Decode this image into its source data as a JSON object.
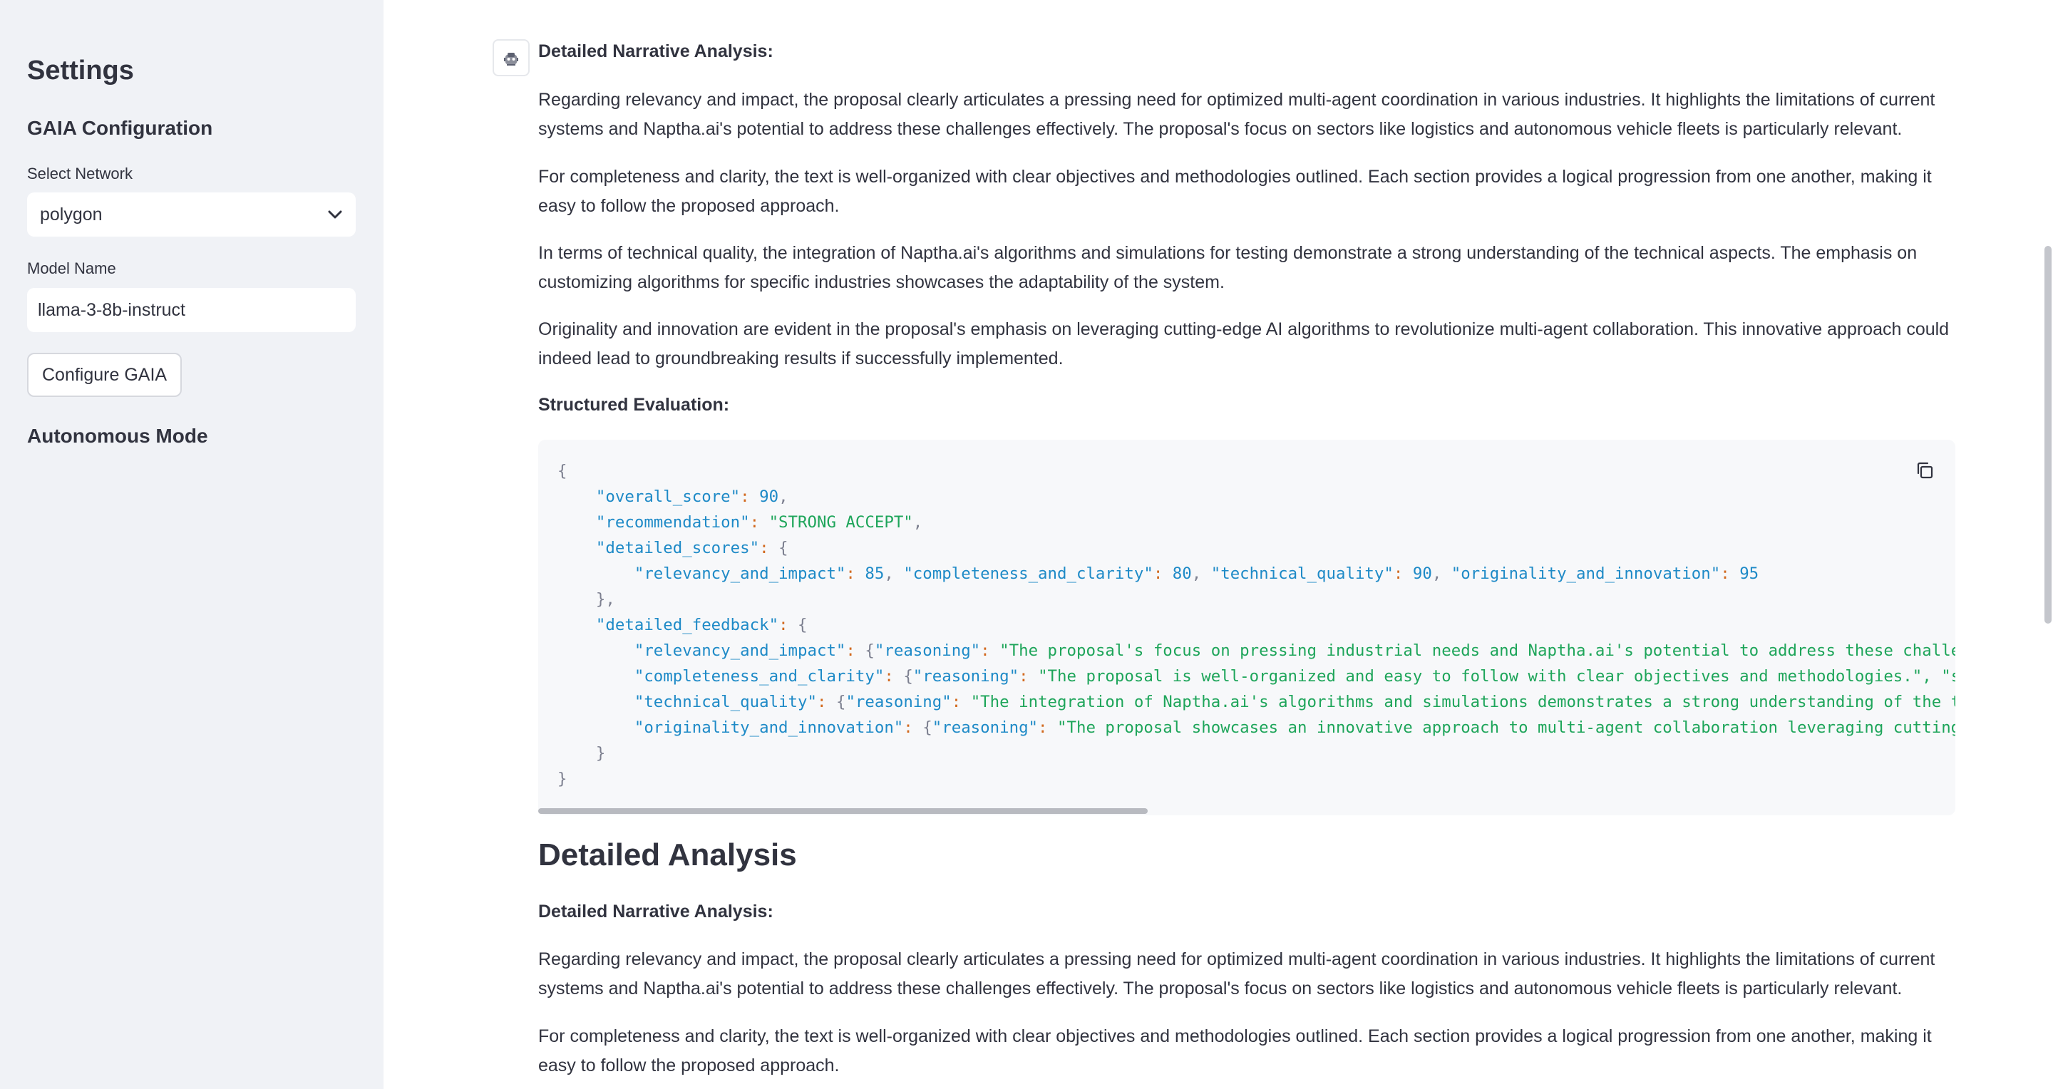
{
  "sidebar": {
    "title": "Settings",
    "section_gaia": "GAIA Configuration",
    "network_label": "Select Network",
    "network_value": "polygon",
    "model_label": "Model Name",
    "model_value": "llama-3-8b-instruct",
    "configure_button": "Configure GAIA",
    "section_autonomous": "Autonomous Mode"
  },
  "message": {
    "narrative_heading": "Detailed Narrative Analysis:",
    "paragraphs": [
      "Regarding relevancy and impact, the proposal clearly articulates a pressing need for optimized multi-agent coordination in various industries. It highlights the limitations of current systems and Naptha.ai's potential to address these challenges effectively. The proposal's focus on sectors like logistics and autonomous vehicle fleets is particularly relevant.",
      "For completeness and clarity, the text is well-organized with clear objectives and methodologies outlined. Each section provides a logical progression from one another, making it easy to follow the proposed approach.",
      "In terms of technical quality, the integration of Naptha.ai's algorithms and simulations for testing demonstrate a strong understanding of the technical aspects. The emphasis on customizing algorithms for specific industries showcases the adaptability of the system.",
      "Originality and innovation are evident in the proposal's emphasis on leveraging cutting-edge AI algorithms to revolutionize multi-agent collaboration. This innovative approach could indeed lead to groundbreaking results if successfully implemented."
    ],
    "structured_heading": "Structured Evaluation:",
    "code": {
      "open": "{",
      "close": "}",
      "overall_key": "\"overall_score\"",
      "overall_val": "90",
      "rec_key": "\"recommendation\"",
      "rec_val": "\"STRONG ACCEPT\"",
      "scores_key": "\"detailed_scores\"",
      "s1_key": "\"relevancy_and_impact\"",
      "s1_val": "85",
      "s2_key": "\"completeness_and_clarity\"",
      "s2_val": "80",
      "s3_key": "\"technical_quality\"",
      "s3_val": "90",
      "s4_key": "\"originality_and_innovation\"",
      "s4_val": "95",
      "feedback_key": "\"detailed_feedback\"",
      "reasoning_key": "\"reasoning\"",
      "f1_key": "\"relevancy_and_impact\"",
      "f1_val": "\"The proposal's focus on pressing industrial needs and Naptha.ai's potential to address these challe",
      "f2_key": "\"completeness_and_clarity\"",
      "f2_val": "\"The proposal is well-organized and easy to follow with clear objectives and methodologies.\"",
      "f2_tail": ", \"s",
      "f3_key": "\"technical_quality\"",
      "f3_val": "\"The integration of Naptha.ai's algorithms and simulations demonstrates a strong understanding of the t",
      "f4_key": "\"originality_and_innovation\"",
      "f4_val": "\"The proposal showcases an innovative approach to multi-agent collaboration leveraging cutting"
    },
    "section_title": "Detailed Analysis",
    "narrative_heading_2": "Detailed Narrative Analysis:",
    "paragraph_repeat_1": "Regarding relevancy and impact, the proposal clearly articulates a pressing need for optimized multi-agent coordination in various industries. It highlights the limitations of current systems and Naptha.ai's potential to address these challenges effectively. The proposal's focus on sectors like logistics and autonomous vehicle fleets is particularly relevant.",
    "paragraph_repeat_2": "For completeness and clarity, the text is well-organized with clear objectives and methodologies outlined. Each section provides a logical progression from one another, making it easy to follow the proposed approach."
  },
  "icons": {
    "avatar": "robot-icon",
    "copy": "copy-icon",
    "dropdown": "chevron-down-icon"
  },
  "colors": {
    "sidebar_bg": "#f0f2f6",
    "code_key": "#1e8ac7",
    "code_string": "#1ea55a",
    "text": "#31333f"
  }
}
